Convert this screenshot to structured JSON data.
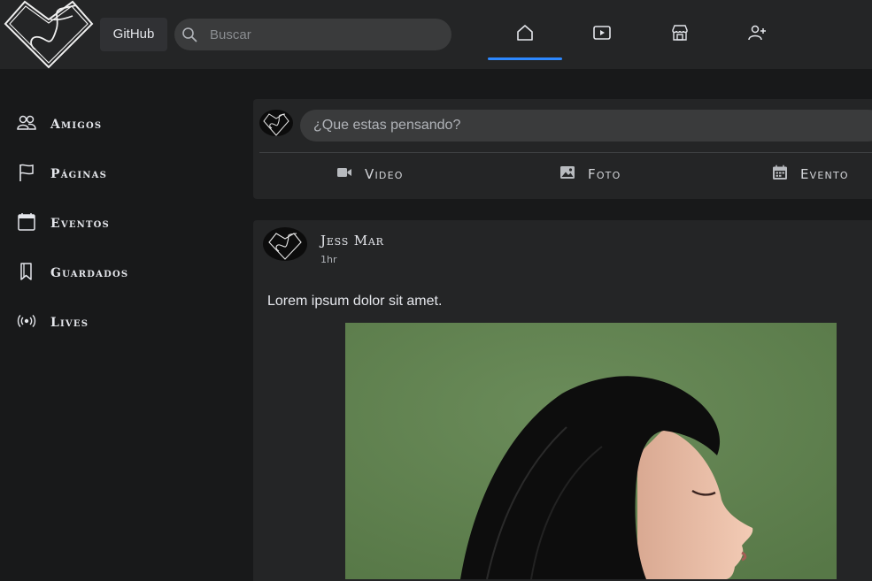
{
  "header": {
    "github_label": "GitHub",
    "search_placeholder": "Buscar",
    "nav": [
      {
        "icon": "home-icon",
        "active": true
      },
      {
        "icon": "video-icon",
        "active": false
      },
      {
        "icon": "store-icon",
        "active": false
      },
      {
        "icon": "add-friend-icon",
        "active": false
      }
    ]
  },
  "sidebar": {
    "items": [
      {
        "label": "Amigos",
        "icon": "friends-icon"
      },
      {
        "label": "Páginas",
        "icon": "flag-icon"
      },
      {
        "label": "Eventos",
        "icon": "calendar-icon"
      },
      {
        "label": "Guardados",
        "icon": "bookmark-icon"
      },
      {
        "label": "Lives",
        "icon": "broadcast-icon"
      }
    ]
  },
  "composer": {
    "placeholder": "¿Que estas pensando?",
    "actions": [
      {
        "label": "Video",
        "icon": "video-camera-icon"
      },
      {
        "label": "Foto",
        "icon": "photo-icon"
      },
      {
        "label": "Evento",
        "icon": "calendar-event-icon"
      }
    ]
  },
  "post": {
    "author": "Jess Mar",
    "time": "1hr",
    "text": "Lorem ipsum dolor sit amet.",
    "image": "portrait-photo"
  },
  "colors": {
    "accent": "#2d88ff",
    "background": "#18191a",
    "card": "#242526",
    "input": "#3a3b3c"
  }
}
